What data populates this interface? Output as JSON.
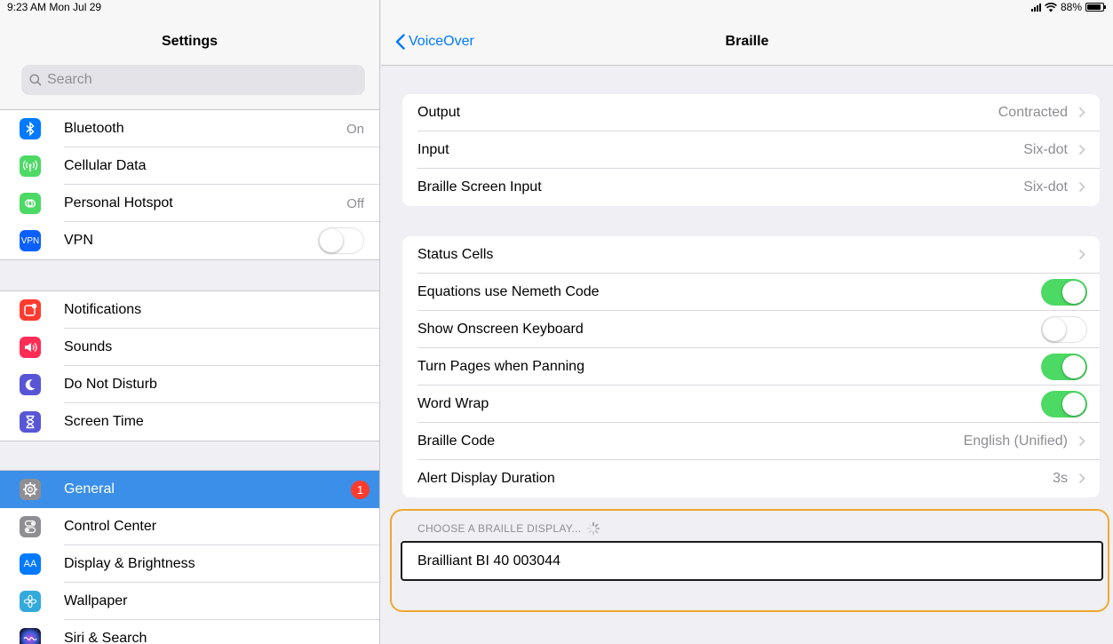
{
  "status_bar": {
    "time": "9:23 AM  Mon Jul 29",
    "battery": "88%"
  },
  "sidebar": {
    "title": "Settings",
    "search_placeholder": "Search",
    "groups": [
      [
        {
          "label": "Bluetooth",
          "value": "On",
          "icon": "bluetooth-icon",
          "color": "#007aff"
        },
        {
          "label": "Cellular Data",
          "value": "",
          "icon": "antenna-icon",
          "color": "#4cd964"
        },
        {
          "label": "Personal Hotspot",
          "value": "Off",
          "icon": "hotspot-icon",
          "color": "#4cd964"
        },
        {
          "label": "VPN",
          "value": "",
          "icon": "vpn-icon",
          "color": "#0a60ff",
          "toggle": false,
          "icon_text": "VPN"
        }
      ],
      [
        {
          "label": "Notifications",
          "icon": "notifications-icon",
          "color": "#ff3b30"
        },
        {
          "label": "Sounds",
          "icon": "speaker-icon",
          "color": "#ff2d55"
        },
        {
          "label": "Do Not Disturb",
          "icon": "moon-icon",
          "color": "#5856d6"
        },
        {
          "label": "Screen Time",
          "icon": "hourglass-icon",
          "color": "#5856d6"
        }
      ],
      [
        {
          "label": "General",
          "icon": "gear-icon",
          "color": "#8e8e93",
          "badge": "1",
          "selected": true
        },
        {
          "label": "Control Center",
          "icon": "switches-icon",
          "color": "#8e8e93"
        },
        {
          "label": "Display & Brightness",
          "icon": "text-size-icon",
          "color": "#007aff",
          "icon_text": "AA"
        },
        {
          "label": "Wallpaper",
          "icon": "flower-icon",
          "color": "#34aadc"
        },
        {
          "label": "Siri & Search",
          "icon": "siri-icon",
          "color": "#1c1c3c"
        }
      ]
    ]
  },
  "detail": {
    "back_label": "VoiceOver",
    "title": "Braille",
    "section1": [
      {
        "label": "Output",
        "value": "Contracted"
      },
      {
        "label": "Input",
        "value": "Six-dot"
      },
      {
        "label": "Braille Screen Input",
        "value": "Six-dot"
      }
    ],
    "section2": [
      {
        "label": "Status Cells",
        "value": "",
        "type": "nav"
      },
      {
        "label": "Equations use Nemeth Code",
        "type": "toggle",
        "on": true
      },
      {
        "label": "Show Onscreen Keyboard",
        "type": "toggle",
        "on": false
      },
      {
        "label": "Turn Pages when Panning",
        "type": "toggle",
        "on": true
      },
      {
        "label": "Word Wrap",
        "type": "toggle",
        "on": true
      },
      {
        "label": "Braille Code",
        "value": "English (Unified)",
        "type": "nav"
      },
      {
        "label": "Alert Display Duration",
        "value": "3s",
        "type": "nav"
      }
    ],
    "display_caption": "CHOOSE A BRAILLE DISPLAY...",
    "display_device": "Brailliant BI 40 003044"
  },
  "colors": {
    "accent": "#007aff",
    "toggle_on": "#4cd964",
    "selected_row": "#3b8fe8",
    "highlight_outline": "#f0a830"
  }
}
